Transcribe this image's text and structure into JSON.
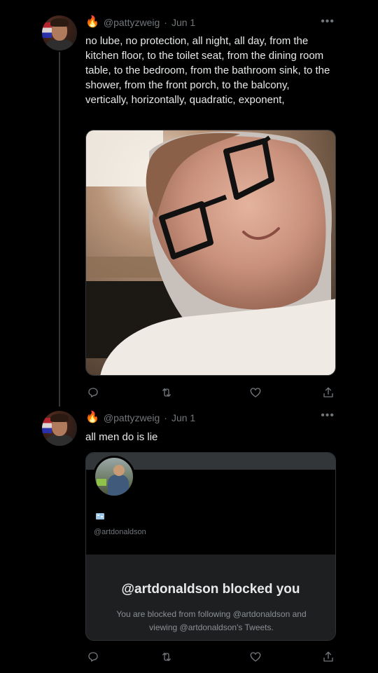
{
  "tweets": [
    {
      "emoji": "🔥",
      "handle": "@pattyzweig",
      "separator": "·",
      "date": "Jun 1",
      "text": "no lube, no protection, all night, all day, from the kitchen floor, to the toilet seat, from the dining room table, to the bedroom, from the bathroom sink, to the shower, from the front porch, to the balcony, vertically, horizontally, quadratic, exponent,",
      "more": "•••"
    },
    {
      "emoji": "🔥",
      "handle": "@pattyzweig",
      "separator": "·",
      "date": "Jun 1",
      "text": "all men do is lie",
      "more": "•••",
      "quote": {
        "handle": "@artdonaldson",
        "blocked_title": "@artdonaldson blocked you",
        "blocked_message": "You are blocked from following @artdonaldson and viewing @artdonaldson's Tweets."
      }
    }
  ],
  "icons": {
    "reply": "reply-icon",
    "retweet": "retweet-icon",
    "like": "like-icon",
    "share": "share-icon"
  },
  "colors": {
    "background": "#000000",
    "text": "#e7e9ea",
    "muted": "#71767b",
    "border": "#2f3336"
  }
}
